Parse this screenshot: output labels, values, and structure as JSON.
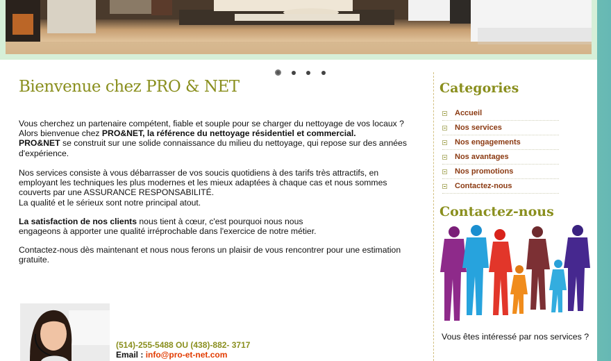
{
  "slider": {
    "dot_count": 4,
    "active_index": 0
  },
  "main": {
    "title": "Bienvenue chez PRO & NET",
    "p1_line1": "Vous cherchez un partenaire compétent, fiable et souple pour se charger du nettoyage de vos locaux ?",
    "p1_line2_pre": "Alors bienvenue chez ",
    "p1_line2_bold": "PRO&NET, la référence du nettoyage résidentiel et commercial.",
    "p1_line3_bold": "PRO&NET",
    "p1_line3_rest": " se construit sur une solide connaissance du milieu du nettoyage, qui repose sur des années",
    "p1_line4": "d'expérience.",
    "p2_line1": "Nos services consiste à vous débarrasser de vos soucis quotidiens à des tarifs très attractifs, en",
    "p2_line2": "employant les techniques les plus modernes et les mieux adaptées à chaque cas et nous sommes",
    "p2_line3": "couverts par une ASSURANCE RESPONSABILITÉ.",
    "p2_line4": "La qualité et le sérieux sont notre principal atout.",
    "p3_bold": "La satisfaction de nos clients",
    "p3_rest": " nous tient à cœur, c'est pourquoi nous nous",
    "p3_line2": "engageons à apporter une qualité irréprochable dans l'exercice de notre métier.",
    "p4_line1": "Contactez-nous dès maintenant et nous nous ferons un plaisir de vous rencontrer pour une estimation",
    "p4_line2": "gratuite."
  },
  "contact": {
    "phone": "(514)-255-5488 OU (438)-882- 3717",
    "email_label": "Email : ",
    "email": "info@pro-et-net.com"
  },
  "sidebar": {
    "categories_title": "Categories",
    "items": [
      {
        "label": "Accueil"
      },
      {
        "label": "Nos services"
      },
      {
        "label": "Nos engagements"
      },
      {
        "label": "Nos avantages"
      },
      {
        "label": "Nos promotions"
      },
      {
        "label": "Contactez-nous"
      }
    ],
    "contact_title": "Contactez-nous",
    "question": "Vous êtes intéressé par nos services ?"
  },
  "colors": {
    "heading": "#8a8f1e",
    "menu_link": "#8b3a12",
    "email_link": "#e23b00"
  }
}
